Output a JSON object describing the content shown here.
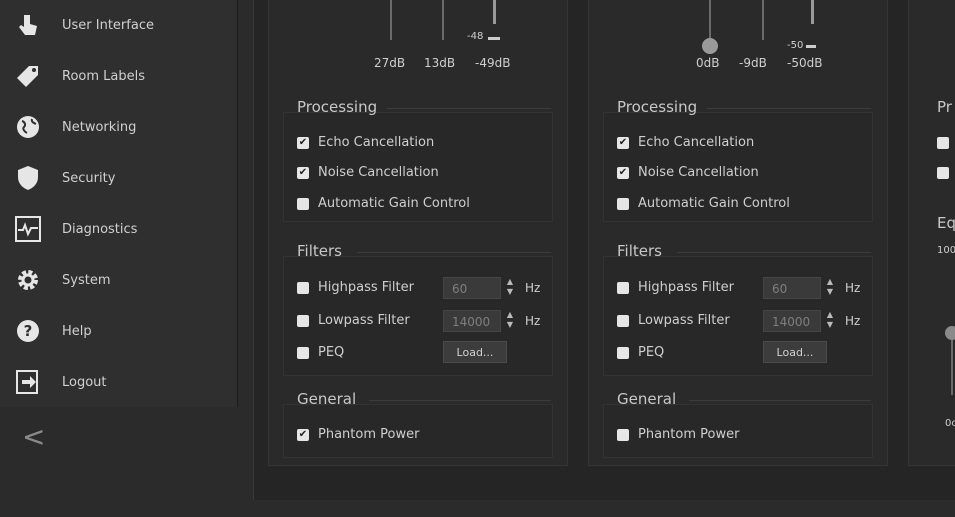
{
  "sidebar": {
    "items": [
      {
        "label": "User Interface",
        "icon": "hand-pointer-icon"
      },
      {
        "label": "Room Labels",
        "icon": "tag-icon"
      },
      {
        "label": "Networking",
        "icon": "globe-icon"
      },
      {
        "label": "Security",
        "icon": "shield-icon"
      },
      {
        "label": "Diagnostics",
        "icon": "pulse-icon"
      },
      {
        "label": "System",
        "icon": "gear-icon"
      },
      {
        "label": "Help",
        "icon": "question-icon"
      },
      {
        "label": "Logout",
        "icon": "logout-icon"
      }
    ],
    "collapse_label": "<"
  },
  "channels": [
    {
      "fader_readout": "-48",
      "db_labels": [
        "27dB",
        "13dB",
        "-49dB"
      ],
      "processing_title": "Processing",
      "processing": [
        {
          "label": "Echo Cancellation",
          "checked": true
        },
        {
          "label": "Noise Cancellation",
          "checked": true
        },
        {
          "label": "Automatic Gain Control",
          "checked": false
        }
      ],
      "filters_title": "Filters",
      "highpass": {
        "label": "Highpass Filter",
        "value": "60",
        "unit": "Hz"
      },
      "lowpass": {
        "label": "Lowpass Filter",
        "value": "14000",
        "unit": "Hz"
      },
      "peq": {
        "label": "PEQ",
        "button": "Load..."
      },
      "general_title": "General",
      "phantom": {
        "label": "Phantom Power",
        "checked": true
      }
    },
    {
      "fader_readout": "-50",
      "db_labels": [
        "0dB",
        "-9dB",
        "-50dB"
      ],
      "processing_title": "Processing",
      "processing": [
        {
          "label": "Echo Cancellation",
          "checked": true
        },
        {
          "label": "Noise Cancellation",
          "checked": true
        },
        {
          "label": "Automatic Gain Control",
          "checked": false
        }
      ],
      "filters_title": "Filters",
      "highpass": {
        "label": "Highpass Filter",
        "value": "60",
        "unit": "Hz"
      },
      "lowpass": {
        "label": "Lowpass Filter",
        "value": "14000",
        "unit": "Hz"
      },
      "peq": {
        "label": "PEQ",
        "button": "Load..."
      },
      "general_title": "General",
      "phantom": {
        "label": "Phantom Power",
        "checked": false
      }
    }
  ],
  "partial_channel": {
    "processing_title": "Pr",
    "eq_title": "Eq",
    "eq_value": "100",
    "fader_label": "0c"
  },
  "colors": {
    "check_fill": "#e6e6e6",
    "background": "#2b2b2b",
    "text": "#d0d0d0"
  }
}
